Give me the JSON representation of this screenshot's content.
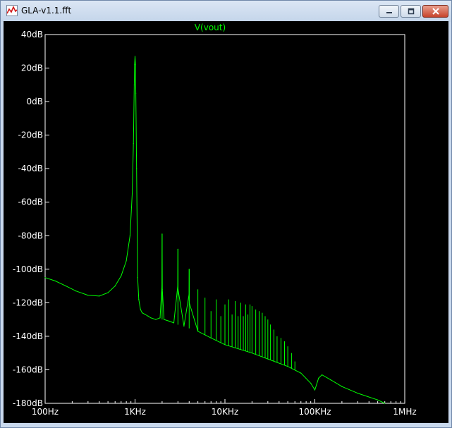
{
  "window": {
    "title": "GLA-v1.1.fft",
    "buttons": {
      "minimize": "minimize",
      "maximize": "maximize",
      "close": "close"
    }
  },
  "colors": {
    "background": "#000000",
    "trace": "#00ff00",
    "axis": "#ffffff",
    "title": "#00ff00"
  },
  "icons": [
    "chart-app-icon",
    "minimize-icon",
    "maximize-icon",
    "close-icon"
  ],
  "chart_data": {
    "type": "line",
    "title": "V(vout)",
    "xlabel": "",
    "ylabel": "",
    "xscale": "log",
    "xlim": [
      100,
      1000000
    ],
    "ylim": [
      -180,
      40
    ],
    "grid": false,
    "y_ticks": [
      40,
      20,
      0,
      -20,
      -40,
      -60,
      -80,
      -100,
      -120,
      -140,
      -160,
      -180
    ],
    "y_tick_labels": [
      "40dB",
      "20dB",
      "0dB",
      "-20dB",
      "-40dB",
      "-60dB",
      "-80dB",
      "-100dB",
      "-120dB",
      "-140dB",
      "-160dB",
      "-180dB"
    ],
    "x_ticks": [
      100,
      1000,
      10000,
      100000,
      1000000
    ],
    "x_tick_labels": [
      "100Hz",
      "1KHz",
      "10KHz",
      "100KHz",
      "1MHz"
    ],
    "series": [
      {
        "name": "V(vout)",
        "color": "#00ff00",
        "x": [
          100,
          130,
          170,
          220,
          300,
          400,
          500,
          600,
          700,
          800,
          880,
          930,
          960,
          980,
          990,
          1000,
          1010,
          1020,
          1040,
          1070,
          1100,
          1150,
          1200,
          1300,
          1400,
          1500,
          1700,
          1900,
          1990,
          2000,
          2010,
          2100,
          2400,
          2700,
          2990,
          3000,
          3010,
          3500,
          3990,
          4000,
          4010,
          5000,
          7000,
          10000,
          20000,
          50000,
          70000,
          90000,
          100000,
          110000,
          120000,
          150000,
          200000,
          300000,
          500000,
          600000
        ],
        "y": [
          -105,
          -107,
          -110,
          -113,
          -115.5,
          -116,
          -114,
          -110,
          -104,
          -95,
          -80,
          -55,
          -25,
          10,
          22,
          27,
          22,
          5,
          -40,
          -105,
          -118,
          -124,
          -126,
          -127,
          -128,
          -129,
          -130,
          -129,
          -110,
          -79,
          -112,
          -130,
          -131,
          -132,
          -110,
          -88,
          -112,
          -134,
          -115,
          -100,
          -120,
          -137,
          -141,
          -145,
          -150,
          -158,
          -162,
          -168,
          -172,
          -165,
          -163,
          -166,
          -170,
          -174,
          -178,
          -180
        ]
      }
    ],
    "harmonics": {
      "fundamental_hz": 1000,
      "x": [
        2000,
        3000,
        4000,
        5000,
        6000,
        7000,
        8000,
        9000,
        10000,
        11000,
        12000,
        13000,
        14000,
        15000,
        16000,
        17000,
        18000,
        19000,
        20000,
        22000,
        24000,
        26000,
        28000,
        30000,
        32000,
        35000,
        38000,
        42000,
        46000,
        50000,
        55000,
        60000
      ],
      "y": [
        -79,
        -88,
        -100,
        -112,
        -117,
        -125,
        -118,
        -128,
        -121,
        -118,
        -127,
        -119,
        -128,
        -120,
        -128,
        -121,
        -127,
        -121,
        -122,
        -124,
        -125,
        -126,
        -128,
        -130,
        -133,
        -136,
        -140,
        -141,
        -143,
        -146,
        -150,
        -155
      ]
    }
  }
}
